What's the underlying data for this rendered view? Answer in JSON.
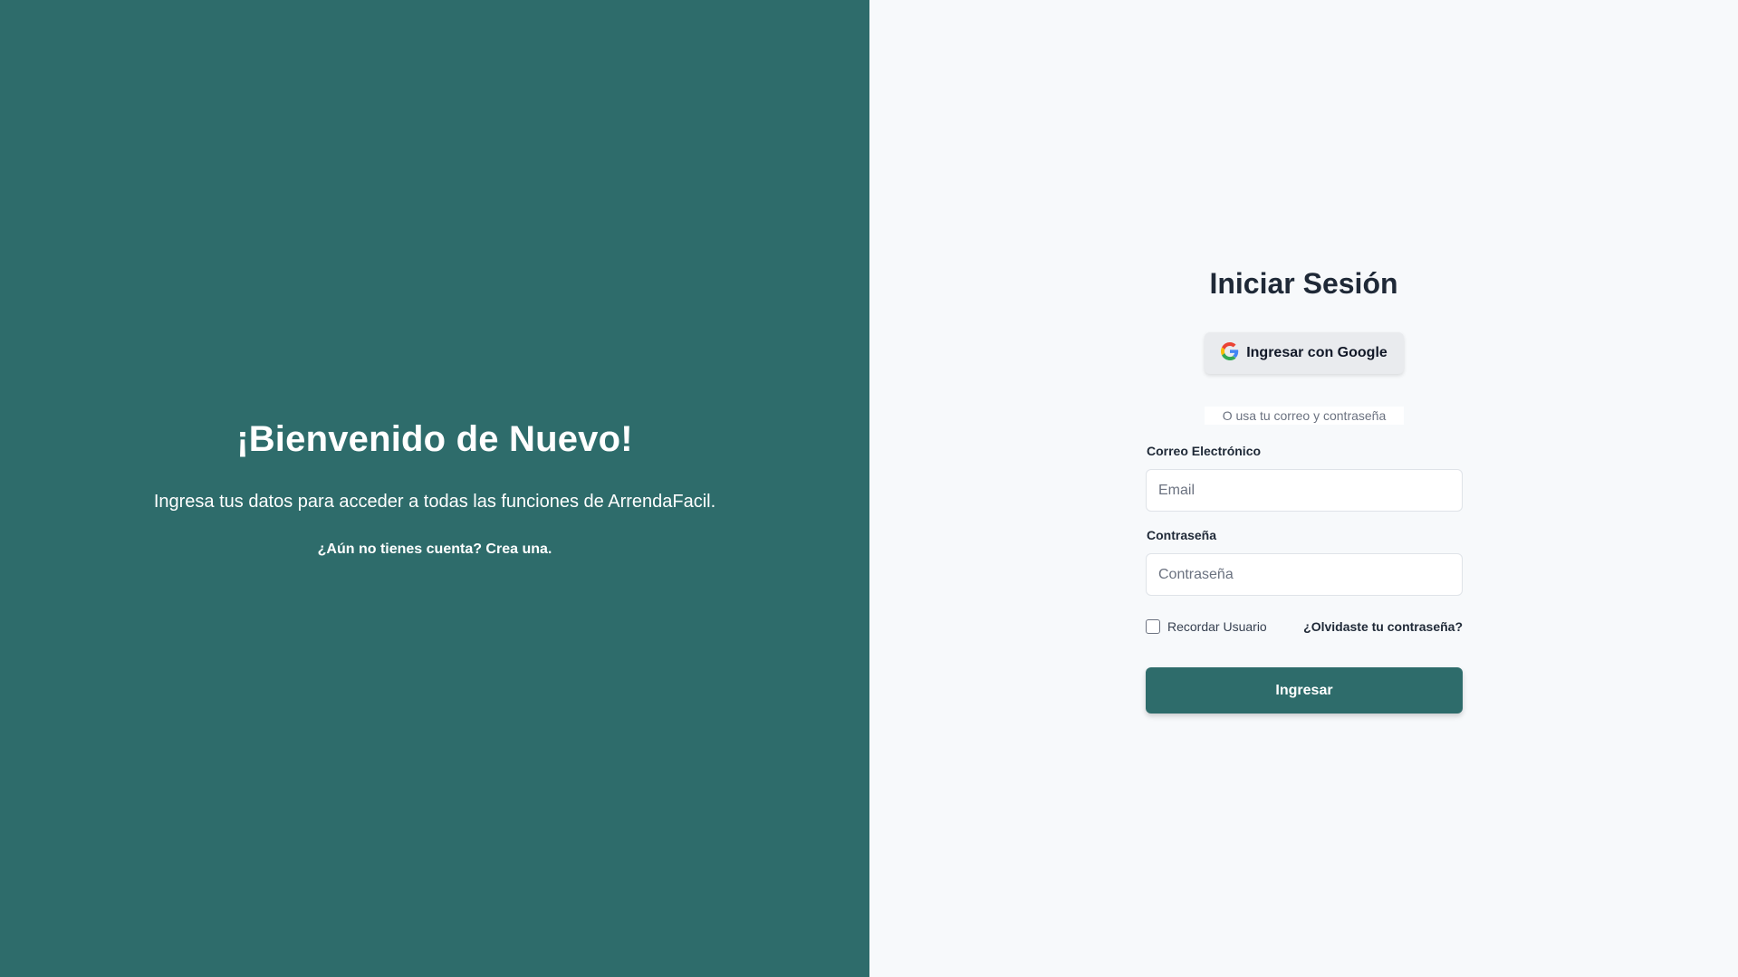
{
  "welcome": {
    "title": "¡Bienvenido de Nuevo!",
    "subtitle": "Ingresa tus datos para acceder a todas las funciones de ArrendaFacil.",
    "signup_link": "¿Aún no tienes cuenta? Crea una."
  },
  "login": {
    "title": "Iniciar Sesión",
    "google_button": "Ingresar con Google",
    "divider": "O usa tu correo y contraseña",
    "email_label": "Correo Electrónico",
    "email_placeholder": "Email",
    "email_value": "",
    "password_label": "Contraseña",
    "password_placeholder": "Contraseña",
    "password_value": "",
    "remember_label": "Recordar Usuario",
    "remember_checked": false,
    "forgot_link": "¿Olvidaste tu contraseña?",
    "submit_button": "Ingresar"
  },
  "icons": {
    "google": "google-icon",
    "checkbox": "checkbox-unchecked-icon"
  },
  "colors": {
    "brand": "#2e6c6b",
    "panel_background": "#f7f9fb",
    "google_button_bg": "#e9ebee"
  }
}
